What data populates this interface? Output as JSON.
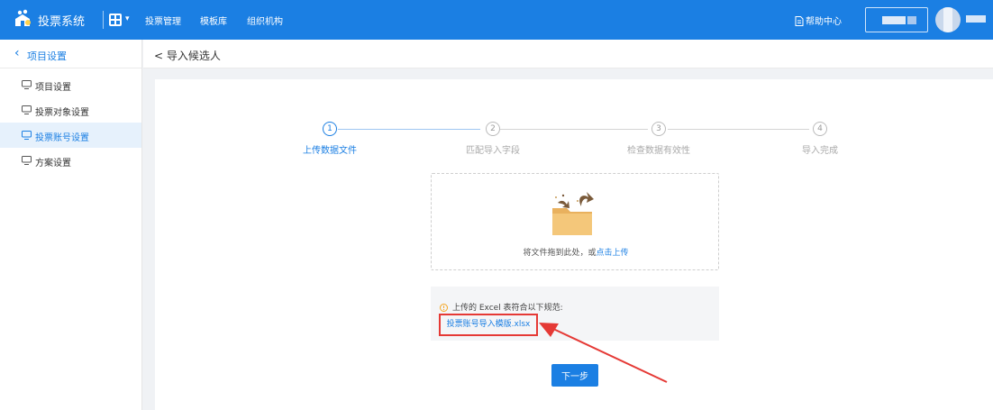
{
  "header": {
    "app_title": "投票系统",
    "nav": [
      "投票管理",
      "模板库",
      "组织机构"
    ],
    "help": "帮助中心"
  },
  "sidebar": {
    "back_label": "项目设置",
    "items": [
      {
        "label": "项目设置",
        "active": false
      },
      {
        "label": "投票对象设置",
        "active": false
      },
      {
        "label": "投票账号设置",
        "active": true
      },
      {
        "label": "方案设置",
        "active": false
      }
    ]
  },
  "page": {
    "breadcrumb": "< 导入候选人"
  },
  "steps": [
    {
      "num": "1",
      "label": "上传数据文件",
      "active": true
    },
    {
      "num": "2",
      "label": "匹配导入字段",
      "active": false
    },
    {
      "num": "3",
      "label": "检查数据有效性",
      "active": false
    },
    {
      "num": "4",
      "label": "导入完成",
      "active": false
    }
  ],
  "upload": {
    "drop_prefix": "将文件拖到此处，或",
    "drop_link": "点击上传",
    "notice": "上传的 Excel 表符合以下规范:",
    "template_link": "投票账号导入模版.xlsx"
  },
  "actions": {
    "next": "下一步"
  },
  "colors": {
    "primary": "#1b7fe3",
    "highlight": "#e53935"
  }
}
